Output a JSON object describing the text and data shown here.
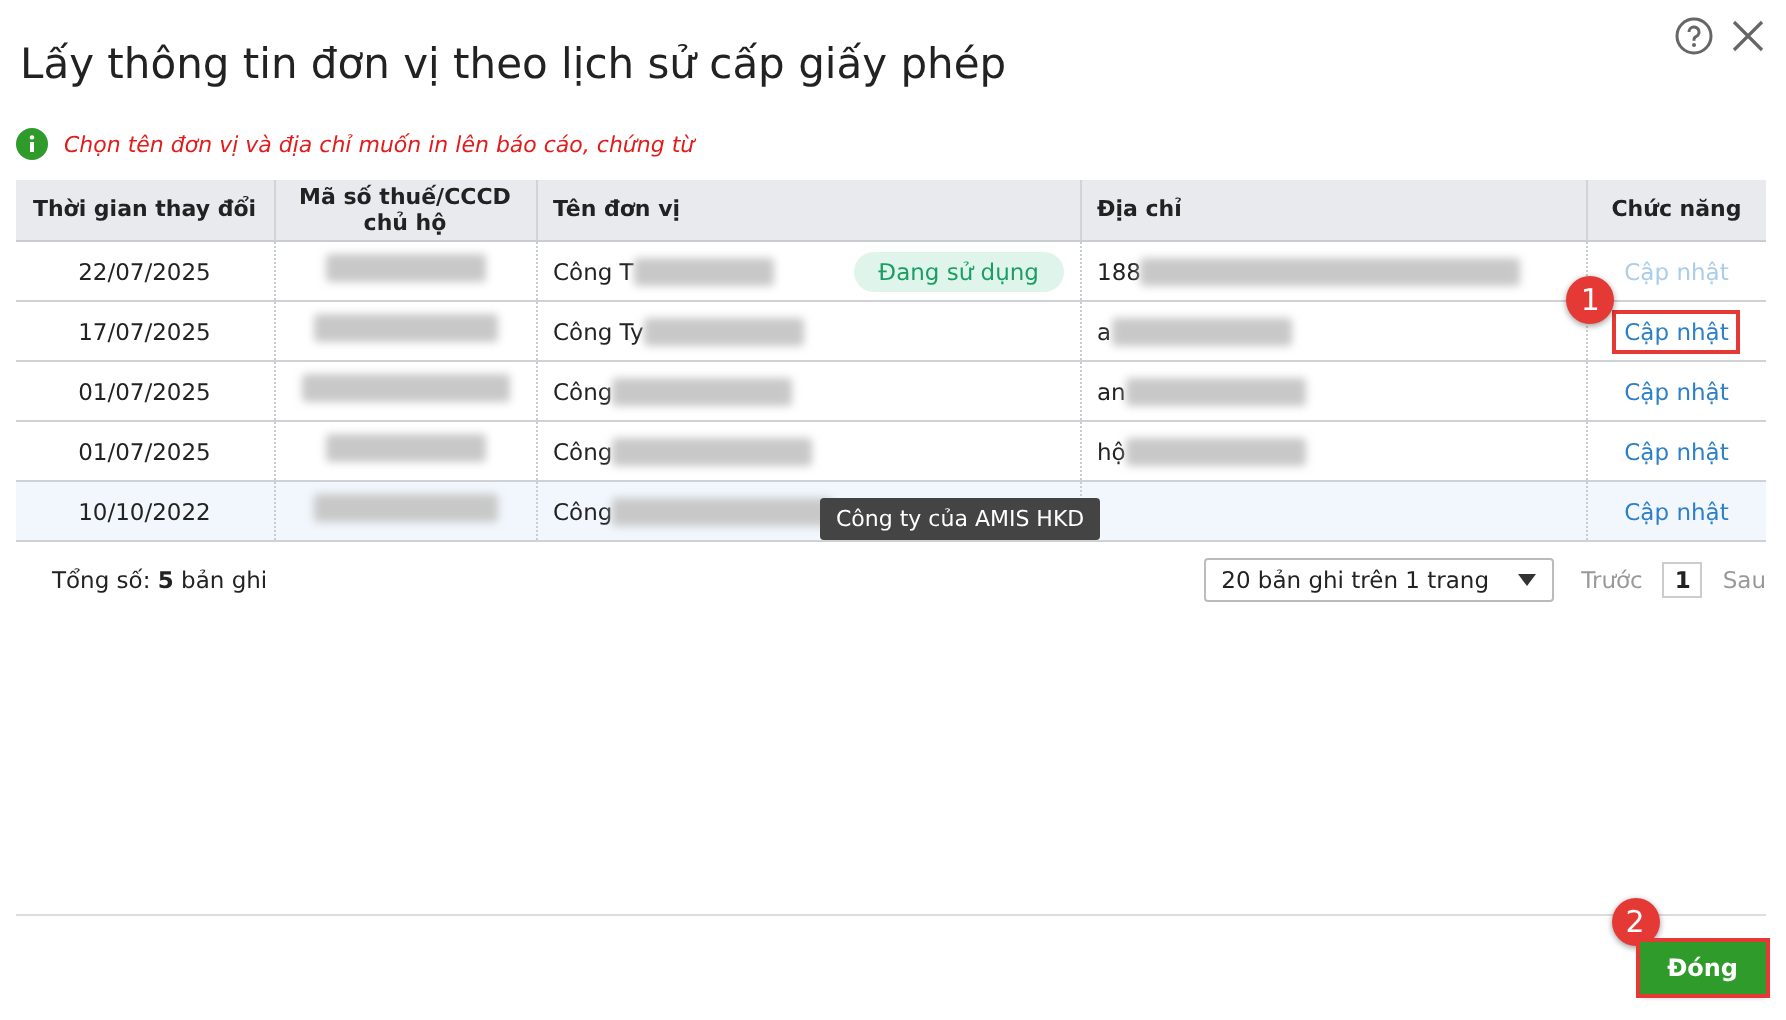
{
  "window": {
    "title": "Lấy thông tin đơn vị theo lịch sử cấp giấy phép"
  },
  "notice": "Chọn tên đơn vị và địa chỉ muốn in lên báo cáo, chứng từ",
  "table": {
    "columns": [
      "Thời gian thay đổi",
      "Mã số thuế/CCCD chủ hộ",
      "Tên đơn vị",
      "Địa chỉ",
      "Chức năng"
    ],
    "rows": [
      {
        "date": "22/07/2025",
        "tax_id_blurred": true,
        "name": "Công T",
        "badge": "Đang sử dụng",
        "address": "188",
        "action": "Cập nhật",
        "disabled": true,
        "highlighted": false,
        "callout": ""
      },
      {
        "date": "17/07/2025",
        "tax_id_blurred": true,
        "name": "Công Ty",
        "address": "a",
        "action": "Cập nhật",
        "disabled": false,
        "highlighted": false,
        "callout": "1"
      },
      {
        "date": "01/07/2025",
        "tax_id_blurred": true,
        "name": "Công",
        "address": "an",
        "action": "Cập nhật",
        "disabled": false,
        "highlighted": false,
        "callout": ""
      },
      {
        "date": "01/07/2025",
        "tax_id_blurred": true,
        "name": "Công",
        "address": "hộ",
        "action": "Cập nhật",
        "disabled": false,
        "highlighted": false,
        "callout": ""
      },
      {
        "date": "10/10/2022",
        "tax_id_blurred": true,
        "name": "Công",
        "address": "",
        "action": "Cập nhật",
        "disabled": false,
        "highlighted": true,
        "callout": ""
      }
    ]
  },
  "tooltip": "Công ty của AMIS HKD",
  "footer": {
    "total": "Tổng số: **5** bản ghi",
    "page_size": "20 bản ghi trên 1 trang",
    "prev": "Trước",
    "page": "1",
    "next": "Sau"
  },
  "close_button": {
    "label": "Đóng",
    "callout": "2"
  }
}
